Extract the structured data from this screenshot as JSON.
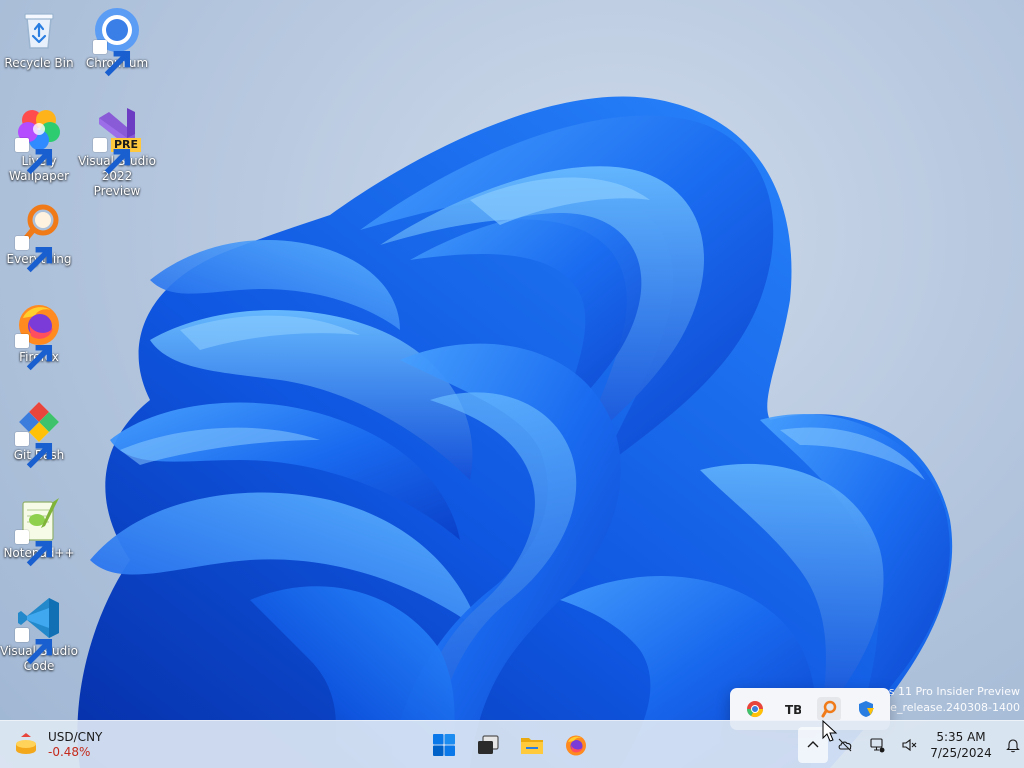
{
  "desktop": {
    "icons": [
      {
        "label": "Recycle Bin",
        "icon": "recycle-bin-icon"
      },
      {
        "label": "Chromium",
        "icon": "chromium-icon"
      },
      {
        "label": "Lively Wallpaper",
        "icon": "lively-wallpaper-icon"
      },
      {
        "label": "Visual Studio 2022 Preview",
        "icon": "visual-studio-icon",
        "badge": "PRE"
      },
      {
        "label": "Everything",
        "icon": "everything-search-icon"
      },
      {
        "label": "Firefox",
        "icon": "firefox-icon"
      },
      {
        "label": "Git Bash",
        "icon": "git-bash-icon"
      },
      {
        "label": "Notepad++",
        "icon": "notepad-plus-plus-icon"
      },
      {
        "label": "Visual Studio Code",
        "icon": "vscode-icon"
      }
    ]
  },
  "watermark": {
    "line1": "s 11 Pro Insider Preview",
    "line2": "ge_release.240308-1400"
  },
  "widget": {
    "title": "USD/CNY",
    "change": "-0.48%",
    "change_color": "#c42b1c"
  },
  "taskbar": {
    "apps": [
      {
        "name": "start-button",
        "icon": "windows-logo-icon"
      },
      {
        "name": "task-view-button",
        "icon": "task-view-icon"
      },
      {
        "name": "file-explorer-button",
        "icon": "folder-icon"
      },
      {
        "name": "firefox-taskbar-button",
        "icon": "firefox-icon"
      }
    ],
    "accent": "#0067c0"
  },
  "tray_flyout": {
    "items": [
      "chromium-tray-icon",
      "tb-tray-icon",
      "everything-tray-icon",
      "windows-security-icon"
    ]
  },
  "tray": {
    "items": [
      "chevron-up-icon",
      "onedrive-offline-icon",
      "network-icon",
      "volume-muted-icon"
    ]
  },
  "clock": {
    "time": "5:35 AM",
    "date": "7/25/2024"
  }
}
